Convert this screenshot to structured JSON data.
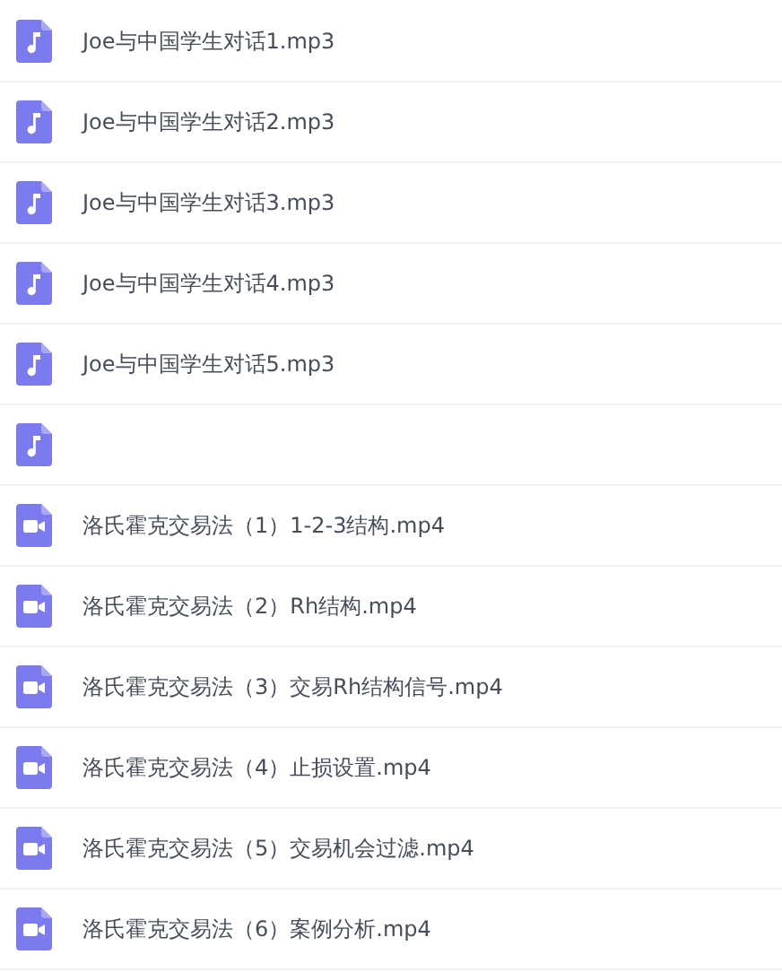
{
  "files": [
    {
      "kind": "audio",
      "name": "Joe与中国学生对话1.mp3"
    },
    {
      "kind": "audio",
      "name": "Joe与中国学生对话2.mp3"
    },
    {
      "kind": "audio",
      "name": "Joe与中国学生对话3.mp3"
    },
    {
      "kind": "audio",
      "name": "Joe与中国学生对话4.mp3"
    },
    {
      "kind": "audio",
      "name": "Joe与中国学生对话5.mp3"
    },
    {
      "kind": "audio"
    },
    {
      "kind": "video",
      "name": "洛氏霍克交易法（1）1-2-3结构.mp4"
    },
    {
      "kind": "video",
      "name": "洛氏霍克交易法（2）Rh结构.mp4"
    },
    {
      "kind": "video",
      "name": "洛氏霍克交易法（3）交易Rh结构信号.mp4"
    },
    {
      "kind": "video",
      "name": "洛氏霍克交易法（4）止损设置.mp4"
    },
    {
      "kind": "video",
      "name": "洛氏霍克交易法（5）交易机会过滤.mp4"
    },
    {
      "kind": "video",
      "name": "洛氏霍克交易法（6）案例分析.mp4"
    }
  ]
}
